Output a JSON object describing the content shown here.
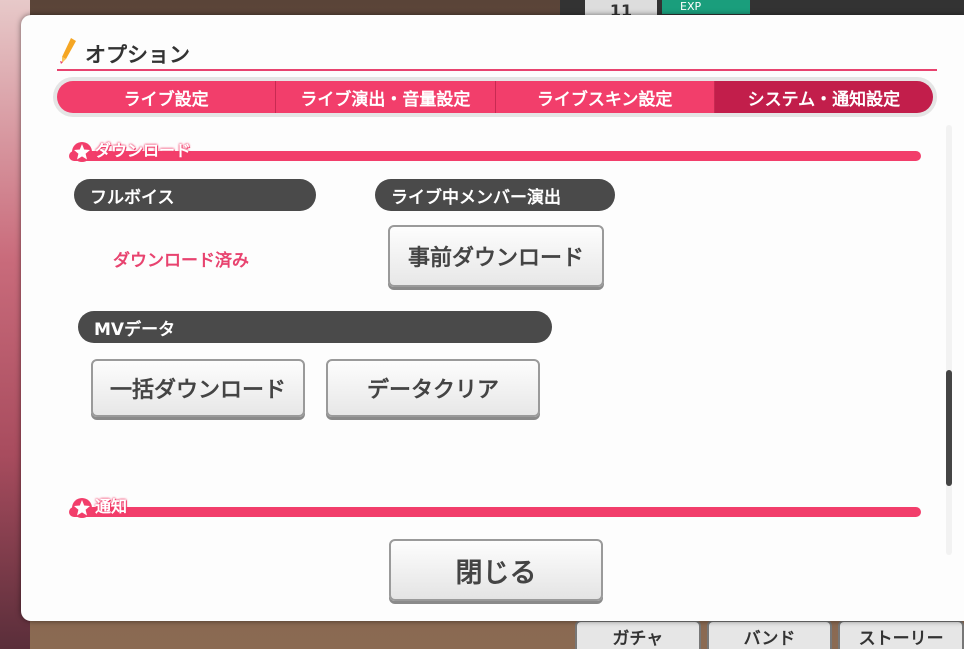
{
  "background": {
    "level_text": "11",
    "exp_label": "EXP",
    "bottom_tabs": [
      "ガチャ",
      "バンド",
      "ストーリー"
    ]
  },
  "dialog": {
    "title": "オプション",
    "tabs": [
      {
        "label": "ライブ設定",
        "active": false
      },
      {
        "label": "ライブ演出・音量設定",
        "active": false
      },
      {
        "label": "ライブスキン設定",
        "active": false
      },
      {
        "label": "システム・通知設定",
        "active": true
      }
    ],
    "download_section": {
      "heading": "ダウンロード",
      "full_voice": {
        "label": "フルボイス",
        "status": "ダウンロード済み"
      },
      "live_member": {
        "label": "ライブ中メンバー演出",
        "button": "事前ダウンロード"
      },
      "mv_data": {
        "label": "MVデータ",
        "download_button": "一括ダウンロード",
        "clear_button": "データクリア"
      }
    },
    "notify_section": {
      "heading": "通知"
    },
    "close_button": "閉じる"
  },
  "colors": {
    "accent": "#f23e6b",
    "active_tab": "#c21e4b",
    "pill": "#4a4a4a"
  }
}
